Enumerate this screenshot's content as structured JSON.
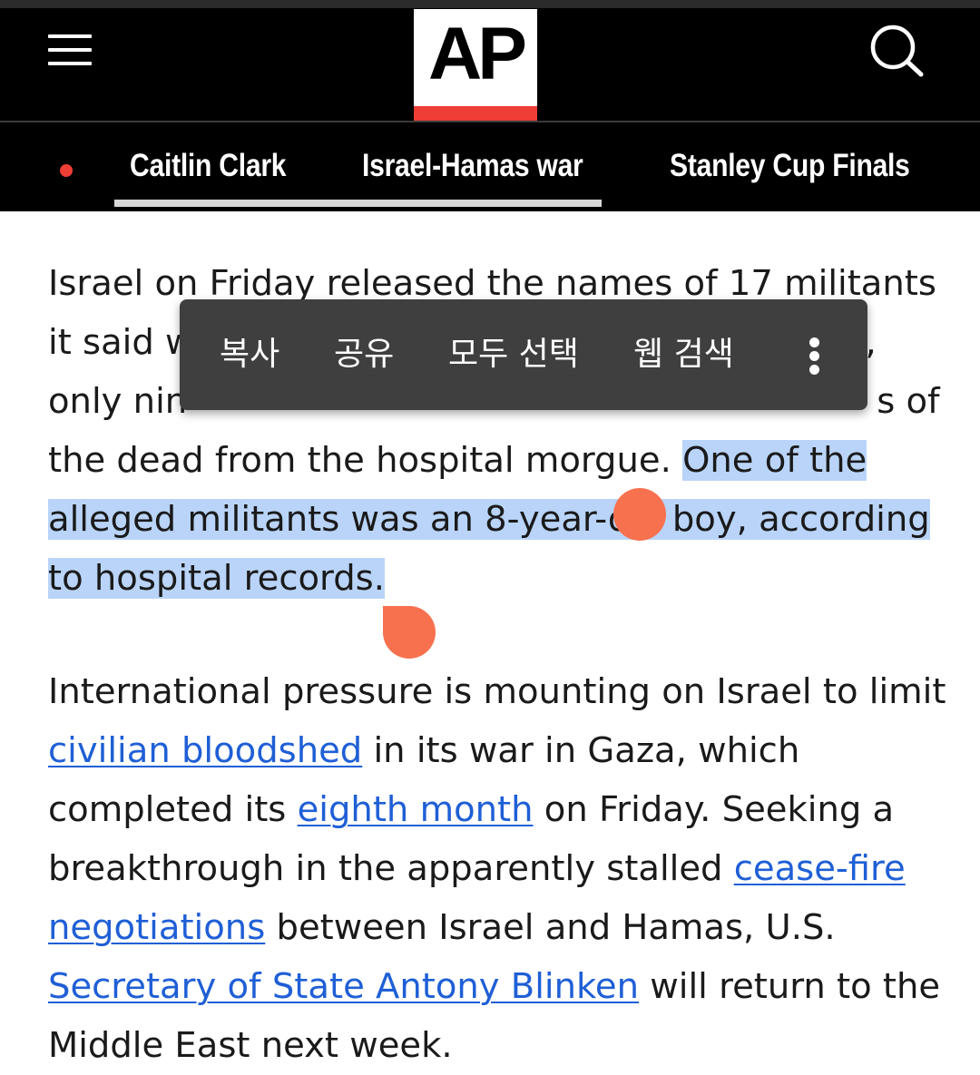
{
  "header": {
    "logo_text": "AP",
    "menu_icon": "hamburger-menu-icon",
    "search_icon": "search-icon",
    "brand_red": "#ef3e36"
  },
  "nav": {
    "items": [
      {
        "label": "Caitlin Clark"
      },
      {
        "label": "Israel-Hamas war"
      },
      {
        "label": "Stanley Cup Finals"
      }
    ],
    "live_indicator_color": "#ef3e36"
  },
  "article": {
    "p1": {
      "line1": "Israel on Friday released the names of 17 militants",
      "line2_start": "it said w",
      "line2_end": ",",
      "line3_start": "only nin",
      "line3_end": "s of",
      "line4": "the dead from the hospital morgue. ",
      "selected_a": "One of the",
      "selected_b": "alleged militants was an 8-year-old boy, according",
      "selected_c": "to hospital records."
    },
    "p2": {
      "t1": "International pressure is mounting on Israel to limit ",
      "link1": "civilian bloodshed",
      "t2": " in its war in Gaza, which completed its ",
      "link2": "eighth month",
      "t3": " on Friday. Seeking a breakthrough in the apparently stalled ",
      "link3": "cease-fire negotiations",
      "t4": " between Israel and Hamas, U.S. ",
      "link4": "Secretary of State Antony Blinken",
      "t5": " will return to the Middle East next week."
    }
  },
  "selection_toolbar": {
    "copy": "복사",
    "share": "공유",
    "select_all": "모두 선택",
    "web_search": "웹 검색",
    "more_icon": "more-vertical-icon"
  },
  "colors": {
    "selection": "#b9d4f8",
    "handle": "#f7714f",
    "link": "#1f5fd6"
  }
}
